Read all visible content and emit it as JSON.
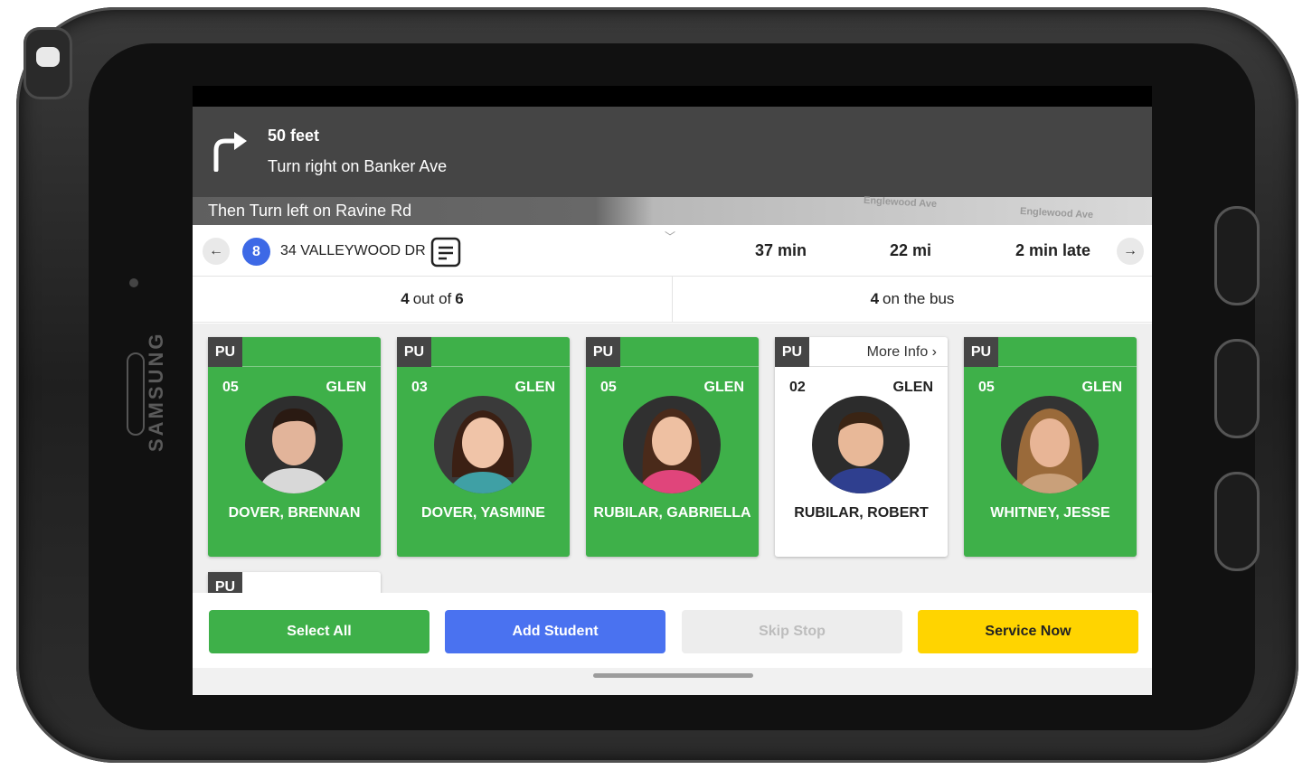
{
  "device": {
    "brand": "SAMSUNG"
  },
  "navigation": {
    "distance": "50 feet",
    "instruction": "Turn right on Banker Ave",
    "next_instruction": "Then Turn left on Ravine Rd",
    "map_labels": [
      "Englewood Ave",
      "Englewood Ave"
    ]
  },
  "stop": {
    "number": "8",
    "address": "34 VALLEYWOOD DR",
    "eta": "37 min",
    "distance": "22 mi",
    "status": "2 min late"
  },
  "counts": {
    "serviced": "4",
    "out_of_text": "out of",
    "total": "6",
    "on_bus": "4",
    "on_bus_text": "on the bus"
  },
  "students": [
    {
      "type": "PU",
      "grade": "05",
      "school": "GLEN",
      "name": "DOVER, BRENNAN",
      "selected": true,
      "more_info": ""
    },
    {
      "type": "PU",
      "grade": "03",
      "school": "GLEN",
      "name": "DOVER, YASMINE",
      "selected": true,
      "more_info": ""
    },
    {
      "type": "PU",
      "grade": "05",
      "school": "GLEN",
      "name": "RUBILAR, GABRIELLA",
      "selected": true,
      "more_info": ""
    },
    {
      "type": "PU",
      "grade": "02",
      "school": "GLEN",
      "name": "RUBILAR, ROBERT",
      "selected": false,
      "more_info": "More Info ›"
    },
    {
      "type": "PU",
      "grade": "05",
      "school": "GLEN",
      "name": "WHITNEY, JESSE",
      "selected": true,
      "more_info": ""
    },
    {
      "type": "PU"
    }
  ],
  "actions": {
    "select_all": "Select All",
    "add_student": "Add Student",
    "skip_stop": "Skip Stop",
    "service_now": "Service Now"
  },
  "icons": {
    "turn": "turn-right-icon",
    "back": "arrow-left-icon",
    "forward": "arrow-right-icon",
    "notes": "notes-icon",
    "expand": "chevron-down-icon"
  },
  "colors": {
    "selected_card": "#3eb049",
    "add_button": "#4a72f0",
    "service_button": "#ffd400",
    "stop_badge": "#3d69e6",
    "nav_banner": "#454545"
  }
}
